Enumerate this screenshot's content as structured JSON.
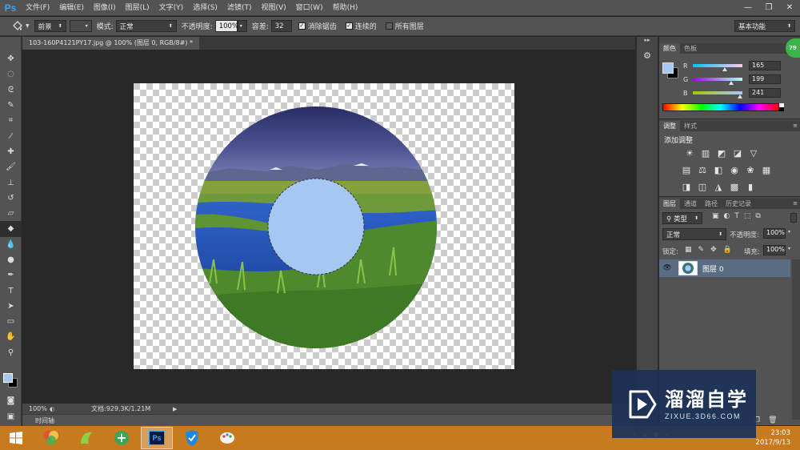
{
  "app": {
    "logo": "Ps"
  },
  "menu": [
    "文件(F)",
    "编辑(E)",
    "图像(I)",
    "图层(L)",
    "文字(Y)",
    "选择(S)",
    "滤镜(T)",
    "视图(V)",
    "窗口(W)",
    "帮助(H)"
  ],
  "window_controls": [
    "—",
    "❐",
    "✕"
  ],
  "options": {
    "tool_icon": "paint-bucket-icon",
    "fill_source": "前景",
    "mode_label": "模式:",
    "mode_value": "正常",
    "opacity_label": "不透明度:",
    "opacity_value": "100%",
    "tolerance_label": "容差:",
    "tolerance_value": "32",
    "antialias_label": "消除锯齿",
    "contiguous_label": "连续的",
    "all_layers_label": "所有图层",
    "workspace": "基本功能"
  },
  "document": {
    "tab_title": "103-160P4121PY17.jpg @ 100% (图层 0, RGB/8#) *"
  },
  "status": {
    "zoom": "100%",
    "doc_info": "文档:929.3K/1.21M",
    "timeline_label": "时间轴"
  },
  "color_panel": {
    "tabs": [
      "颜色",
      "色板"
    ],
    "fg_color": "#a5c7f1",
    "channels": [
      {
        "label": "R",
        "value": "165",
        "fraction": 0.647
      },
      {
        "label": "G",
        "value": "199",
        "fraction": 0.78
      },
      {
        "label": "B",
        "value": "241",
        "fraction": 0.945
      }
    ]
  },
  "adjust_panel": {
    "tabs": [
      "调整",
      "样式"
    ],
    "heading": "添加调整",
    "icons": [
      "brightness-contrast-icon",
      "levels-icon",
      "curves-icon",
      "exposure-icon",
      "vibrance-icon",
      "hue-saturation-icon",
      "color-balance-icon",
      "black-white-icon",
      "photo-filter-icon",
      "channel-mixer-icon",
      "color-lookup-icon",
      "invert-icon",
      "posterize-icon",
      "threshold-icon",
      "selective-color-icon",
      "gradient-map-icon"
    ]
  },
  "layers_panel": {
    "tabs": [
      "图层",
      "通道",
      "路径",
      "历史记录"
    ],
    "filter_kind": "类型",
    "blend_mode": "正常",
    "opacity_label": "不透明度:",
    "opacity_value": "100%",
    "lock_label": "锁定:",
    "fill_label": "填充:",
    "fill_value": "100%",
    "layers": [
      {
        "name": "图层 0",
        "visible": true
      }
    ]
  },
  "watermark": {
    "title": "溜溜自学",
    "subtitle": "ZIXUE.3D66.COM"
  },
  "badge": "79",
  "taskbar": {
    "apps": [
      "windows-start-icon",
      "app-color-icon",
      "app-frog-icon",
      "browser-icon",
      "photoshop-icon",
      "shield-icon",
      "paint-icon"
    ],
    "ps_label": "Ps",
    "time": "23:03",
    "date": "2017/9/13"
  }
}
